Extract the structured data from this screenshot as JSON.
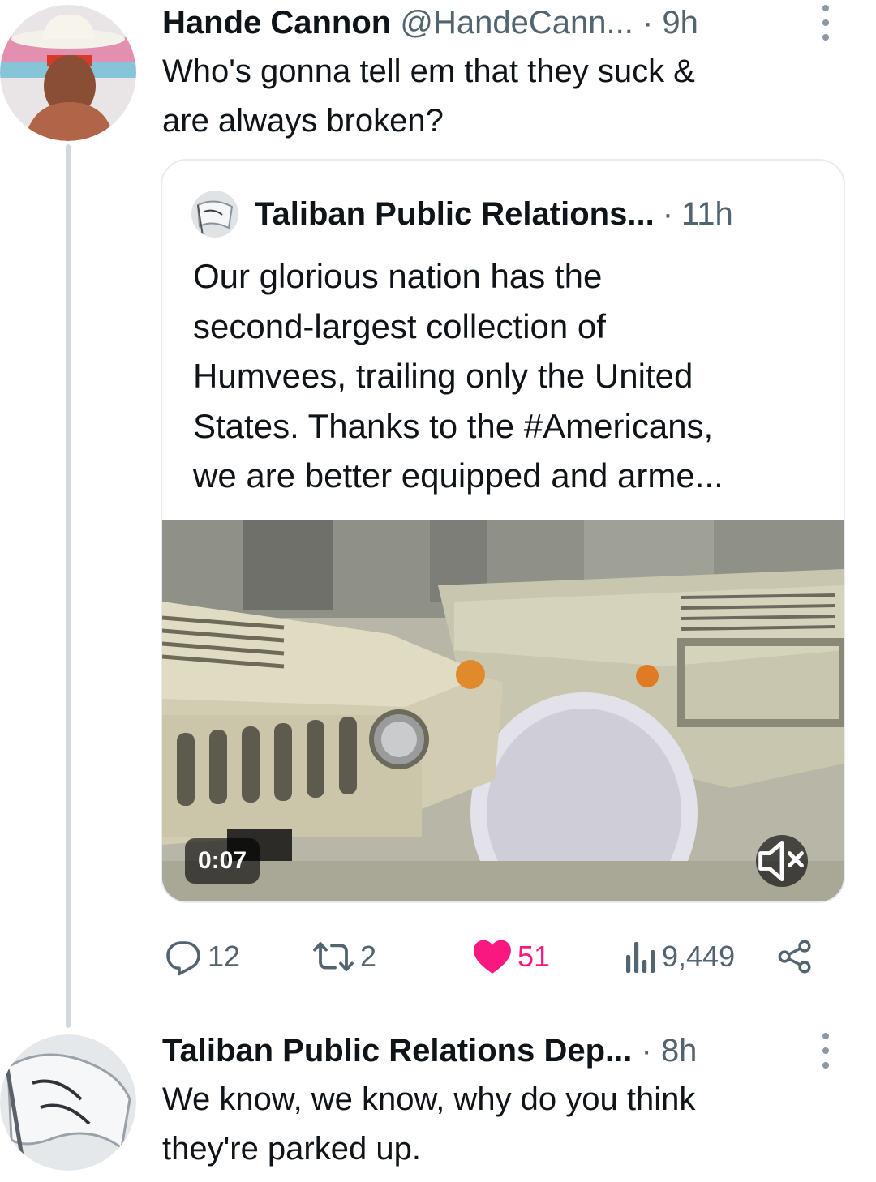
{
  "reply_tweet": {
    "author_name": "Hande Cannon",
    "author_handle": "@HandeCann...",
    "separator": "·",
    "time": "9h",
    "text_line1": "Who's gonna tell em that they suck &",
    "text_line2": "are always broken?",
    "quote": {
      "author_name": "Taliban Public Relations...",
      "separator": "·",
      "time": "11h",
      "text_lines": [
        "Our glorious nation has the",
        "second-largest collection of",
        "Humvees, trailing only the United",
        "States. Thanks to the #Americans,",
        "we are better equipped and arme..."
      ],
      "video_duration": "0:07"
    },
    "metrics": {
      "replies": "12",
      "retweets": "2",
      "likes": "51",
      "views": "9,449"
    }
  },
  "response_tweet": {
    "author_name": "Taliban Public Relations Dep...",
    "separator": "·",
    "time": "8h",
    "text_line1": "We know, we know, why do you think",
    "text_line2": "they're parked up."
  },
  "colors": {
    "like_active": "#f91880",
    "secondary_text": "#536471",
    "thread_line": "#cfd9de"
  },
  "icons": [
    "more-icon",
    "reply-icon",
    "retweet-icon",
    "like-icon",
    "views-icon",
    "share-icon",
    "mute-icon"
  ]
}
